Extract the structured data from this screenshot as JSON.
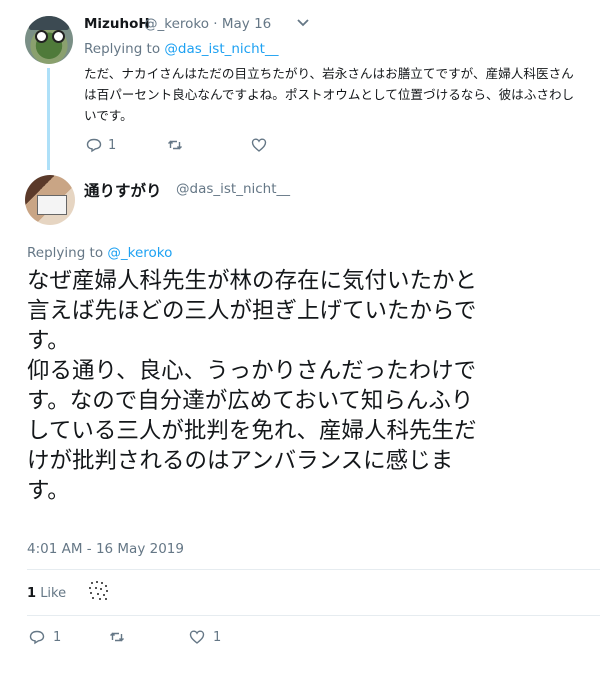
{
  "parent_tweet": {
    "display_name": "MizuhoH",
    "handle_time": "@_keroko · May 16",
    "replying_prefix": "Replying to",
    "replying_mention": "@das_ist_nicht__",
    "text": "ただ、ナカイさんはただの目立ちたがり、岩永さんはお膳立てですが、産婦人科医さんは百パーセント良心なんですよね。ポストオウムとして位置づけるなら、彼はふさわしいです。",
    "reply_count": "1",
    "icons": [
      "reply-icon",
      "retweet-icon",
      "like-icon",
      "chevron-down-icon"
    ]
  },
  "main_tweet": {
    "display_name": "通りすがり",
    "handle": "@das_ist_nicht__",
    "replying_prefix": "Replying to",
    "replying_mention": "@_keroko",
    "text": "なぜ産婦人科先生が林の存在に気付いたかと\n言えば先ほどの三人が担ぎ上げていたからで\nす。\n仰る通り、良心、うっかりさんだったわけで\nす。なので自分達が広めておいて知らんふり\nしている三人が批判を免れ、産婦人科先生だ\nけが批判されるのはアンバランスに感じま\nす。",
    "timestamp": "4:01 AM - 16 May 2019",
    "likes_count": "1",
    "likes_label": "Like",
    "reply_count": "1",
    "like_count": "1",
    "icons": [
      "reply-icon",
      "retweet-icon",
      "like-icon"
    ]
  }
}
